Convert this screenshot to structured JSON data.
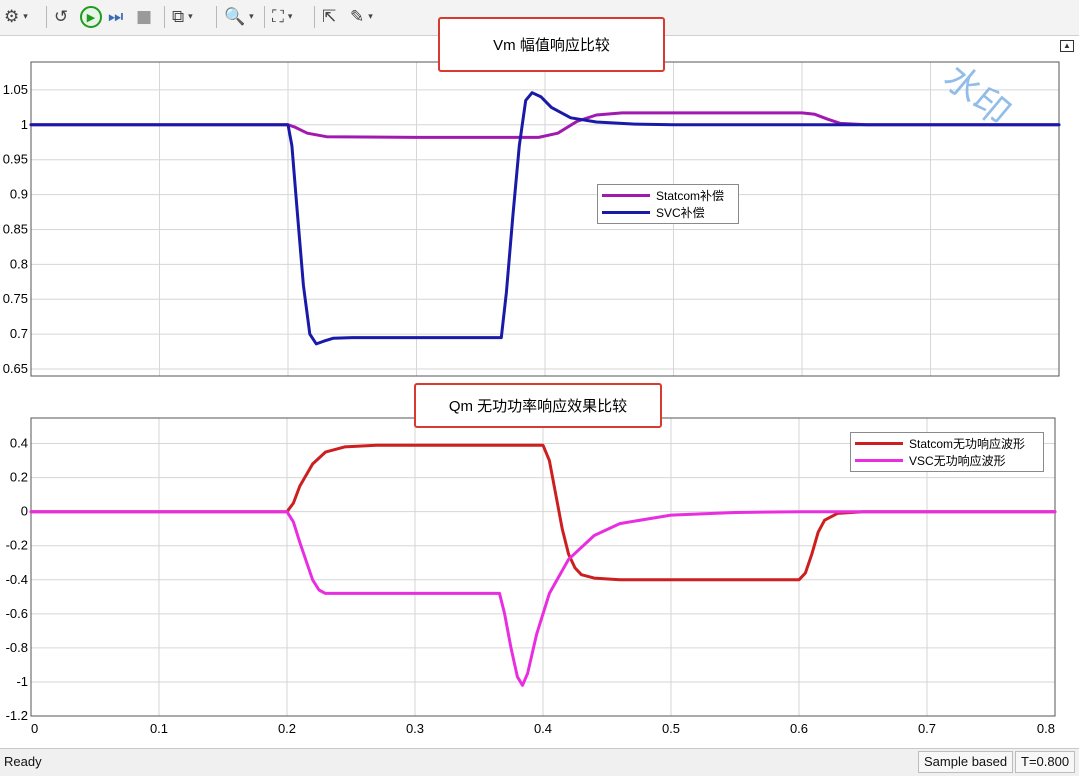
{
  "toolbar": {
    "buttons": [
      {
        "name": "settings-icon",
        "glyph": "⚙",
        "dropdown": true
      },
      {
        "name": "restore-icon",
        "glyph": "↺",
        "dropdown": false
      },
      {
        "name": "run-icon",
        "glyph": "▶",
        "dropdown": false
      },
      {
        "name": "step-forward-icon",
        "glyph": "⏭",
        "dropdown": false
      },
      {
        "name": "stop-icon",
        "glyph": "■",
        "dropdown": false
      },
      {
        "name": "layout-icon",
        "glyph": "⧉",
        "dropdown": true
      },
      {
        "name": "zoom-icon",
        "glyph": "🔍",
        "dropdown": true
      },
      {
        "name": "autoscale-icon",
        "glyph": "⛶",
        "dropdown": true
      },
      {
        "name": "cursor-measure-icon",
        "glyph": "⇱",
        "dropdown": false
      },
      {
        "name": "edit-icon",
        "glyph": "✎",
        "dropdown": true
      }
    ]
  },
  "watermark": "水印",
  "top_title": "Vm 幅值响应比较",
  "bottom_title": "Qm 无功功率响应效果比较",
  "top_legend": [
    {
      "label": "Statcom补偿",
      "color": "#a01ab0"
    },
    {
      "label": "SVC补偿",
      "color": "#1a1aa8"
    }
  ],
  "bottom_legend": [
    {
      "label": "Statcom无功响应波形",
      "color": "#cc1f1f"
    },
    {
      "label": "VSC无功响应波形",
      "color": "#e82ee0"
    }
  ],
  "chart_data": [
    {
      "type": "line",
      "title": "Vm 幅值响应比较",
      "xlim": [
        0,
        0.8
      ],
      "ylim": [
        0.64,
        1.09
      ],
      "yticks": [
        0.65,
        0.7,
        0.75,
        0.8,
        0.85,
        0.9,
        0.95,
        1,
        1.05
      ],
      "ytick_labels": [
        "0.65",
        "0.7",
        "0.75",
        "0.8",
        "0.85",
        "0.9",
        "0.95",
        "1",
        "1.05"
      ],
      "xticks": [
        0,
        0.1,
        0.2,
        0.3,
        0.4,
        0.5,
        0.6,
        0.7,
        0.8
      ],
      "show_xtick_labels": false,
      "grid": true,
      "legend_position": "middle-right",
      "series": [
        {
          "name": "Statcom补偿",
          "color": "#a01ab0",
          "x": [
            0,
            0.2,
            0.205,
            0.215,
            0.23,
            0.3,
            0.35,
            0.395,
            0.41,
            0.425,
            0.44,
            0.46,
            0.6,
            0.61,
            0.62,
            0.63,
            0.65,
            0.8
          ],
          "y": [
            1,
            1,
            0.997,
            0.988,
            0.983,
            0.982,
            0.982,
            0.982,
            0.988,
            1.005,
            1.014,
            1.017,
            1.017,
            1.015,
            1.008,
            1.002,
            1,
            1
          ]
        },
        {
          "name": "SVC补偿",
          "color": "#1a1aa8",
          "x": [
            0,
            0.2,
            0.203,
            0.207,
            0.212,
            0.217,
            0.222,
            0.228,
            0.235,
            0.25,
            0.3,
            0.366,
            0.37,
            0.375,
            0.38,
            0.385,
            0.39,
            0.397,
            0.405,
            0.42,
            0.44,
            0.47,
            0.5,
            0.55,
            0.8
          ],
          "y": [
            1,
            1,
            0.97,
            0.88,
            0.77,
            0.7,
            0.686,
            0.69,
            0.694,
            0.695,
            0.695,
            0.695,
            0.76,
            0.87,
            0.97,
            1.035,
            1.046,
            1.04,
            1.025,
            1.01,
            1.004,
            1.001,
            1,
            1,
            1
          ]
        }
      ]
    },
    {
      "type": "line",
      "title": "Qm 无功功率响应效果比较",
      "xlim": [
        0,
        0.8
      ],
      "ylim": [
        -1.2,
        0.55
      ],
      "yticks": [
        -1.2,
        -1,
        -0.8,
        -0.6,
        -0.4,
        -0.2,
        0,
        0.2,
        0.4
      ],
      "ytick_labels": [
        "-1.2",
        "-1",
        "-0.8",
        "-0.6",
        "-0.4",
        "-0.2",
        "0",
        "0.2",
        "0.4"
      ],
      "xticks": [
        0,
        0.1,
        0.2,
        0.3,
        0.4,
        0.5,
        0.6,
        0.7,
        0.8
      ],
      "xtick_labels": [
        "0",
        "0.1",
        "0.2",
        "0.3",
        "0.4",
        "0.5",
        "0.6",
        "0.7",
        "0.8"
      ],
      "grid": true,
      "legend_position": "top-right",
      "series": [
        {
          "name": "Statcom无功响应波形",
          "color": "#cc1f1f",
          "x": [
            0,
            0.2,
            0.205,
            0.21,
            0.22,
            0.23,
            0.245,
            0.27,
            0.3,
            0.4,
            0.405,
            0.41,
            0.415,
            0.42,
            0.425,
            0.43,
            0.44,
            0.46,
            0.5,
            0.6,
            0.605,
            0.61,
            0.615,
            0.62,
            0.63,
            0.65,
            0.8
          ],
          "y": [
            0,
            0,
            0.05,
            0.15,
            0.28,
            0.35,
            0.38,
            0.39,
            0.39,
            0.39,
            0.3,
            0.1,
            -0.1,
            -0.25,
            -0.33,
            -0.37,
            -0.39,
            -0.4,
            -0.4,
            -0.4,
            -0.36,
            -0.25,
            -0.12,
            -0.05,
            -0.01,
            0,
            0
          ]
        },
        {
          "name": "VSC无功响应波形",
          "color": "#e82ee0",
          "x": [
            0,
            0.2,
            0.205,
            0.21,
            0.22,
            0.225,
            0.23,
            0.3,
            0.366,
            0.37,
            0.375,
            0.38,
            0.384,
            0.388,
            0.395,
            0.405,
            0.42,
            0.44,
            0.46,
            0.5,
            0.55,
            0.6,
            0.8
          ],
          "y": [
            0,
            0,
            -0.06,
            -0.18,
            -0.4,
            -0.46,
            -0.48,
            -0.48,
            -0.48,
            -0.6,
            -0.8,
            -0.97,
            -1.02,
            -0.95,
            -0.72,
            -0.48,
            -0.28,
            -0.14,
            -0.07,
            -0.02,
            -0.005,
            0,
            0
          ]
        }
      ]
    }
  ],
  "status": {
    "text": "Ready",
    "sample": "Sample based",
    "time": "T=0.800"
  }
}
